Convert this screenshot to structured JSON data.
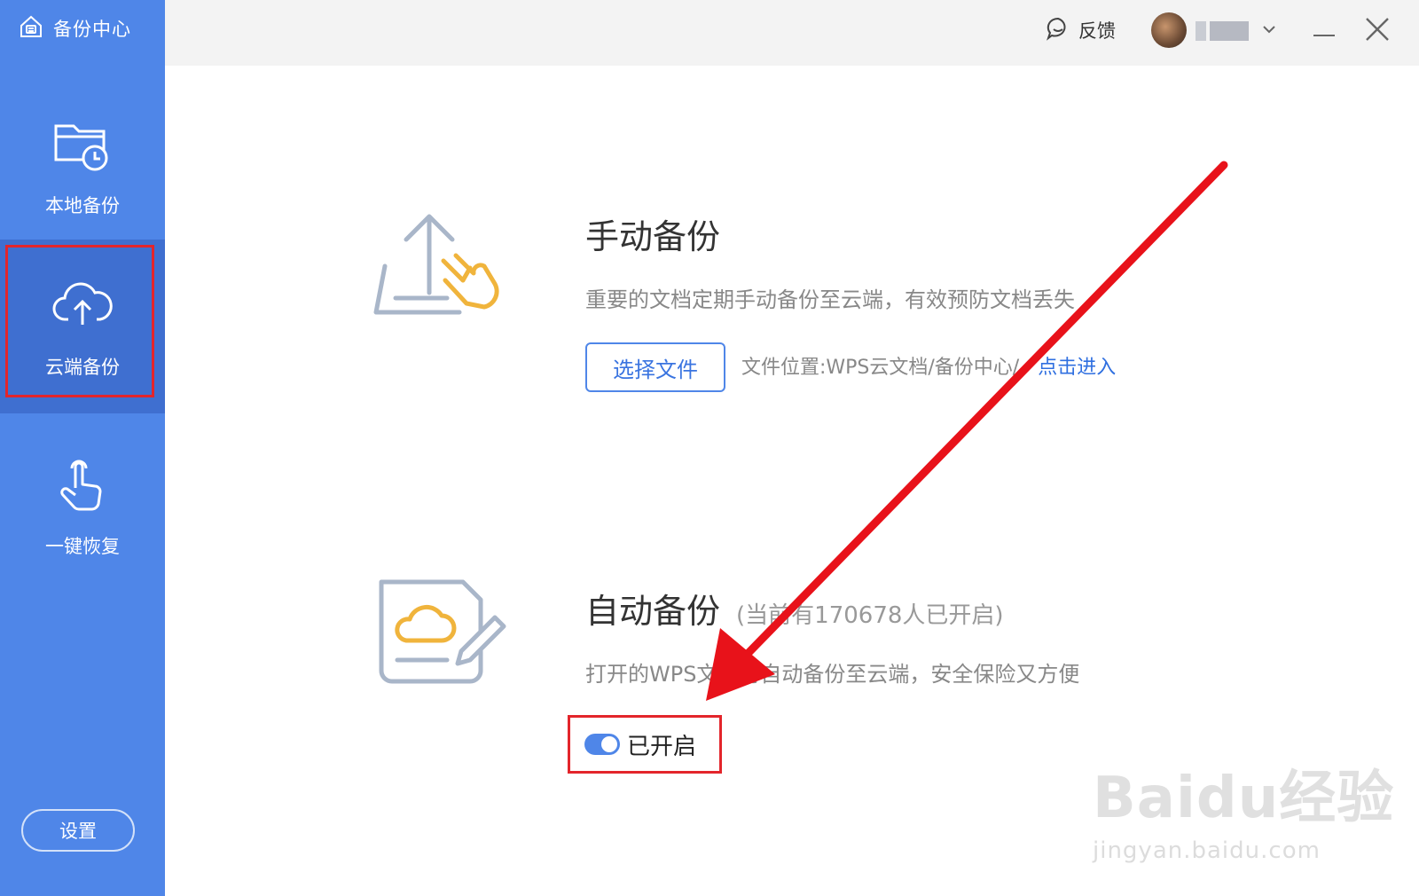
{
  "sidebar": {
    "brand_label": "备份中心",
    "items": [
      {
        "label": "本地备份",
        "icon": "folder-clock-icon"
      },
      {
        "label": "云端备份",
        "icon": "cloud-upload-icon",
        "selected": true
      },
      {
        "label": "一键恢复",
        "icon": "hand-tap-icon"
      }
    ],
    "settings_label": "设置"
  },
  "titlebar": {
    "feedback_label": "反馈"
  },
  "manual_backup": {
    "title": "手动备份",
    "description": "重要的文档定期手动备份至云端，有效预防文档丢失",
    "select_button": "选择文件",
    "location_text": "文件位置:WPS云文档/备份中心/",
    "location_link": "点击进入"
  },
  "auto_backup": {
    "title": "自动备份",
    "subtitle": "(当前有170678人已开启)",
    "description": "打开的WPS文档将自动备份至云端，安全保险又方便",
    "toggle_label": "已开启",
    "toggle_on": true
  },
  "watermark": {
    "brand": "Baidu经验",
    "url": "jingyan.baidu.com"
  },
  "colors": {
    "sidebar": "#4f86e8",
    "sidebar_selected": "#3f6fd0",
    "highlight_red": "#e3252b",
    "link_blue": "#2f6fe0",
    "icon_orange": "#f0b43c"
  }
}
